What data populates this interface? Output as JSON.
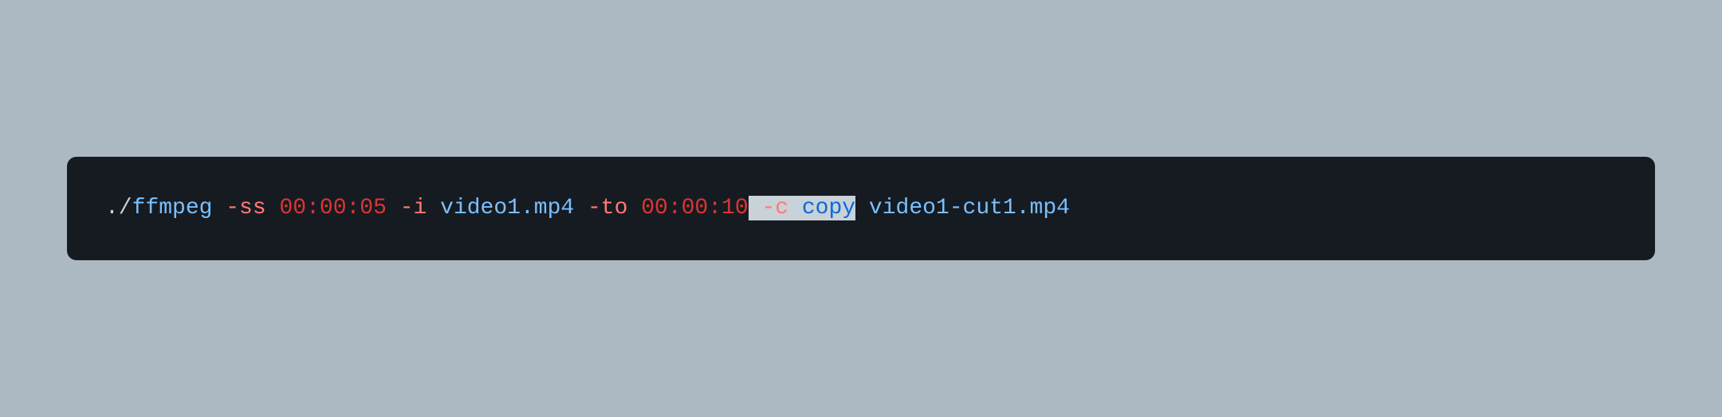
{
  "code": {
    "dot_slash": "./",
    "command": "ffmpeg",
    "flag_ss": "-ss",
    "time_ss": "00:00:05",
    "flag_i": "-i",
    "input_file": "video1.mp4",
    "flag_to": "-to",
    "time_to": "00:00:10",
    "sel_space_before": " ",
    "flag_c": "-c",
    "copy": "copy",
    "output_file": "video1-cut1.mp4"
  }
}
